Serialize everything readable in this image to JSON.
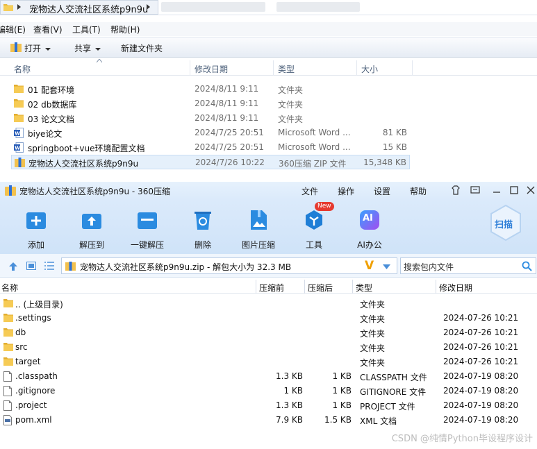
{
  "explorer": {
    "breadcrumb": "宠物达人交流社区系统p9n9u",
    "menu": [
      "编辑(E)",
      "查看(V)",
      "工具(T)",
      "帮助(H)"
    ],
    "toolbar": {
      "open": "打开",
      "share": "共享",
      "new_folder": "新建文件夹"
    },
    "columns": {
      "name": "名称",
      "date": "修改日期",
      "type": "类型",
      "size": "大小"
    },
    "rows": [
      {
        "name": "01 配套环境",
        "date": "2024/8/11 9:11",
        "type": "文件夹",
        "size": "",
        "icon": "folder-icon"
      },
      {
        "name": "02 db数据库",
        "date": "2024/8/11 9:11",
        "type": "文件夹",
        "size": "",
        "icon": "folder-icon"
      },
      {
        "name": "03 论文文档",
        "date": "2024/8/11 9:11",
        "type": "文件夹",
        "size": "",
        "icon": "folder-icon"
      },
      {
        "name": "biye论文",
        "date": "2024/7/25 20:51",
        "type": "Microsoft Word ...",
        "size": "81 KB",
        "icon": "word-doc-icon"
      },
      {
        "name": "springboot+vue环境配置文档",
        "date": "2024/7/25 20:51",
        "type": "Microsoft Word ...",
        "size": "15 KB",
        "icon": "word-doc-icon"
      },
      {
        "name": "宠物达人交流社区系统p9n9u",
        "date": "2024/7/26 10:22",
        "type": "360压缩 ZIP 文件",
        "size": "15,348 KB",
        "icon": "zip-archive-icon"
      }
    ]
  },
  "zip": {
    "title": "宠物达人交流社区系统p9n9u - 360压缩",
    "menu": [
      "文件",
      "操作",
      "设置",
      "帮助"
    ],
    "tools": [
      {
        "label": "添加",
        "icon": "add-icon"
      },
      {
        "label": "解压到",
        "icon": "extract-to-icon"
      },
      {
        "label": "一键解压",
        "icon": "one-click-extract-icon"
      },
      {
        "label": "删除",
        "icon": "trash-icon"
      },
      {
        "label": "图片压缩",
        "icon": "image-compress-icon"
      },
      {
        "label": "工具",
        "icon": "tools-icon",
        "badge": "New"
      },
      {
        "label": "AI办公",
        "icon": "ai-office-icon",
        "glyph": "AI"
      }
    ],
    "scan_label": "扫描",
    "path_text": "宠物达人交流社区系统p9n9u.zip - 解包大小为 32.3 MB",
    "search_placeholder": "搜索包内文件",
    "columns": {
      "name": "名称",
      "compressed": "压缩前",
      "uncompressed": "压缩后",
      "type": "类型",
      "date": "修改日期"
    },
    "rows": [
      {
        "name": ".. (上级目录)",
        "compressed": "",
        "uncompressed": "",
        "type": "文件夹",
        "date": "",
        "icon": "folder-icon"
      },
      {
        "name": ".settings",
        "compressed": "",
        "uncompressed": "",
        "type": "文件夹",
        "date": "2024-07-26 10:21",
        "icon": "folder-icon"
      },
      {
        "name": "db",
        "compressed": "",
        "uncompressed": "",
        "type": "文件夹",
        "date": "2024-07-26 10:21",
        "icon": "folder-icon"
      },
      {
        "name": "src",
        "compressed": "",
        "uncompressed": "",
        "type": "文件夹",
        "date": "2024-07-26 10:21",
        "icon": "folder-icon"
      },
      {
        "name": "target",
        "compressed": "",
        "uncompressed": "",
        "type": "文件夹",
        "date": "2024-07-26 10:21",
        "icon": "folder-icon"
      },
      {
        "name": ".classpath",
        "compressed": "1.3 KB",
        "uncompressed": "1 KB",
        "type": "CLASSPATH 文件",
        "date": "2024-07-19 08:20",
        "icon": "file-icon"
      },
      {
        "name": ".gitignore",
        "compressed": "1 KB",
        "uncompressed": "1 KB",
        "type": "GITIGNORE 文件",
        "date": "2024-07-19 08:20",
        "icon": "file-icon"
      },
      {
        "name": ".project",
        "compressed": "1.3 KB",
        "uncompressed": "1 KB",
        "type": "PROJECT 文件",
        "date": "2024-07-19 08:20",
        "icon": "file-icon"
      },
      {
        "name": "pom.xml",
        "compressed": "7.9 KB",
        "uncompressed": "1.5 KB",
        "type": "XML 文档",
        "date": "2024-07-19 08:20",
        "icon": "xml-file-icon"
      }
    ]
  },
  "watermark": "CSDN @纯情Python毕设程序设计",
  "colors": {
    "accent": "#2b8be0",
    "folder": "#f2c14e",
    "selection": "#e5f0fb"
  }
}
